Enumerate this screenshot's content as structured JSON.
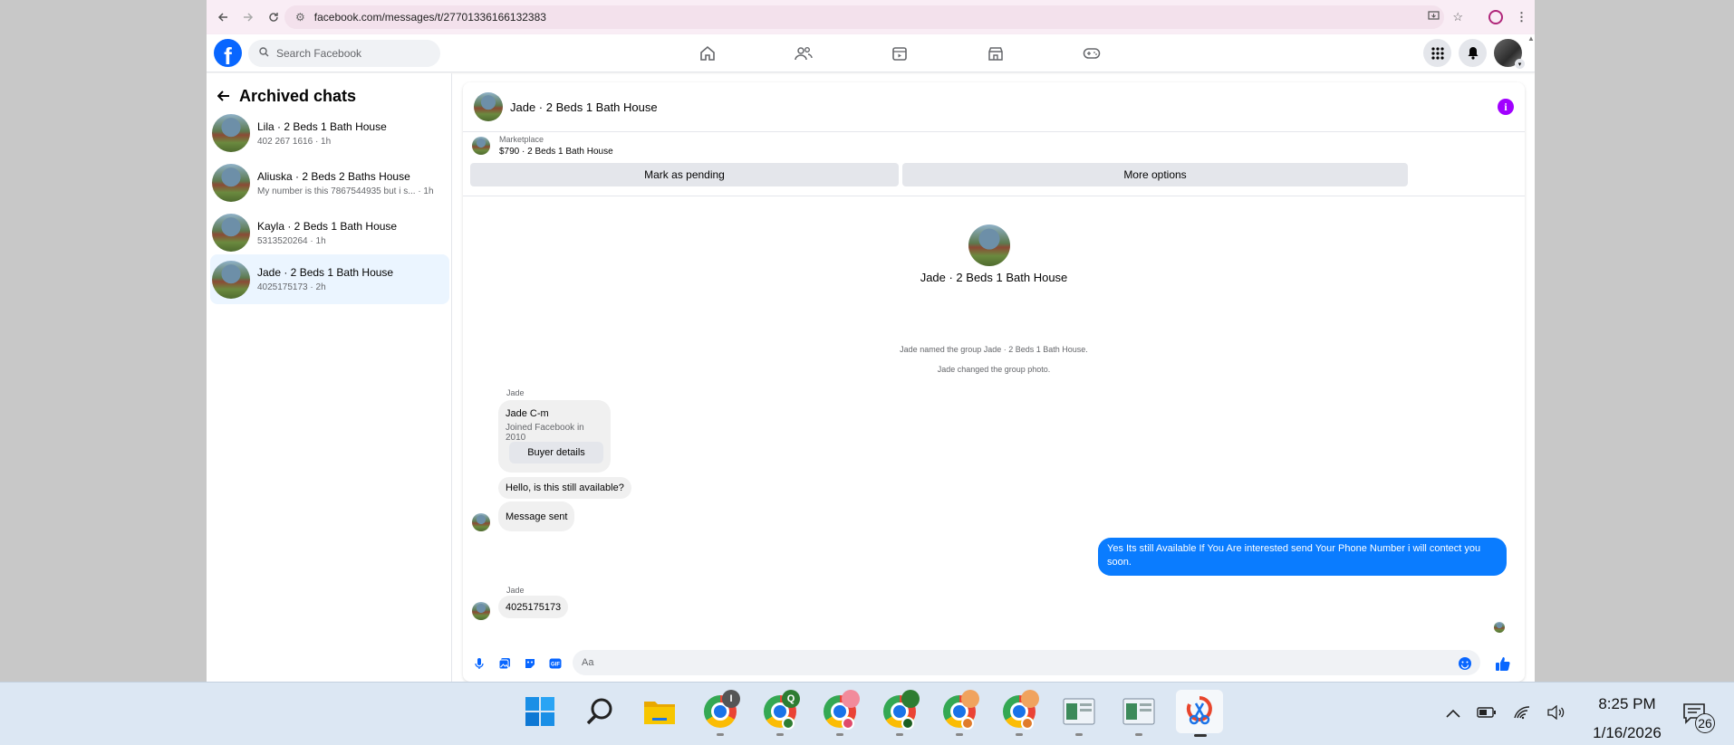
{
  "browser": {
    "url": "facebook.com/messages/t/27701336166132383"
  },
  "fb_header": {
    "search_placeholder": "Search Facebook"
  },
  "sidebar": {
    "title": "Archived chats",
    "chats": [
      {
        "name": "Lila · 2 Beds 1 Bath House",
        "preview": "402 267 1616 · 1h"
      },
      {
        "name": "Aliuska · 2 Beds 2 Baths House",
        "preview": "My number is this 7867544935 but i s... · 1h"
      },
      {
        "name": "Kayla · 2 Beds 1 Bath House",
        "preview": "5313520264 · 1h"
      },
      {
        "name": "Jade · 2 Beds 1 Bath House",
        "preview": "4025175173 · 2h"
      }
    ]
  },
  "conversation": {
    "title": "Jade · 2 Beds 1 Bath House",
    "marketplace_label": "Marketplace",
    "listing": "$790 · 2 Beds 1 Bath House",
    "mark_pending_label": "Mark as pending",
    "more_options_label": "More options",
    "group_name": "Jade · 2 Beds 1 Bath House",
    "system_messages": [
      "Jade named the group Jade · 2 Beds 1 Bath House.",
      "Jade changed the group photo."
    ],
    "sender_1": "Jade",
    "buyer_card": {
      "name": "Jade C-m",
      "joined": "Joined Facebook in 2010",
      "button_label": "Buyer details"
    },
    "msg_1": "Hello, is this still available?",
    "msg_2": "Message sent",
    "outgoing_msg": "Yes Its still Available If You Are interested send Your Phone Number i will contect you soon.",
    "sender_2": "Jade",
    "msg_3": "4025175173",
    "composer_placeholder": "Aa"
  },
  "taskbar": {
    "chrome_badges": [
      "I",
      "Q"
    ],
    "time": "8:25 PM",
    "date": "1/16/2026",
    "notification_count": "26"
  }
}
